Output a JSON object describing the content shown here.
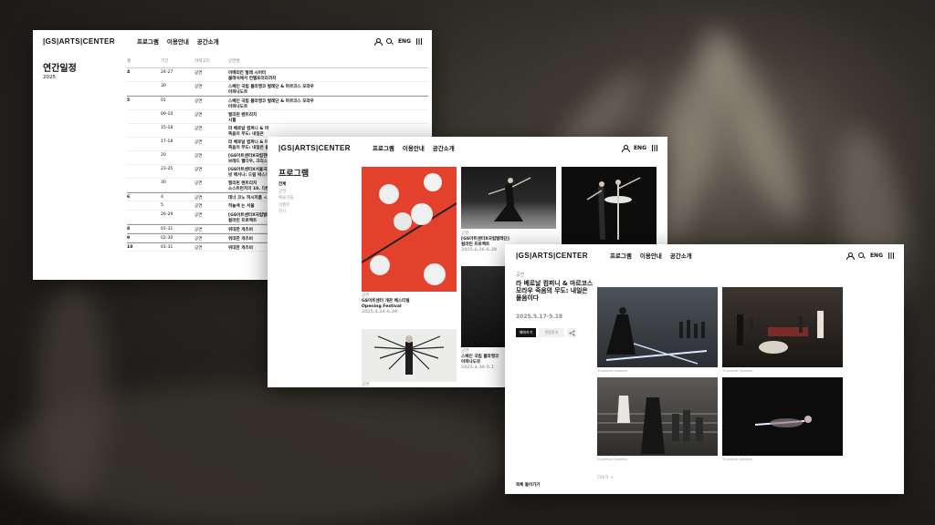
{
  "brand": {
    "logo": "|GS|ARTS|CENTER"
  },
  "nav": {
    "items": [
      "프로그램",
      "이용안내",
      "공간소개"
    ],
    "lang": "ENG"
  },
  "schedule_page": {
    "title": "연간일정",
    "year": "2025",
    "columns": [
      "월",
      "기간",
      "카테고리",
      "공연명"
    ],
    "rows": [
      {
        "month": "4",
        "period": "24-27",
        "category": "공연",
        "title": "아메리칸 발레 시어터",
        "title2": "클래식에서 컨템포러리까지",
        "new_month": true
      },
      {
        "month": "",
        "period": "30",
        "category": "공연",
        "title": "스페인 국립 플라멩코 발레단 & 마르코스 모라우",
        "title2": "아파나도르"
      },
      {
        "month": "5",
        "period": "01",
        "category": "공연",
        "title": "스페인 국립 플라멩코 발레단 & 마르코스 모라우",
        "title2": "아파나도르",
        "new_month": true
      },
      {
        "month": "",
        "period": "09-10",
        "category": "공연",
        "title": "필리핀 렌트리치",
        "title2": "시월"
      },
      {
        "month": "",
        "period": "15-18",
        "category": "공연",
        "title": "라 베로날 컴퍼니 & 마",
        "title2": "죽음의 무도: 내일은"
      },
      {
        "month": "",
        "period": "17-18",
        "category": "공연",
        "title": "라 베로날 컴퍼니 & 마",
        "title2": "죽음의 무도: 내일은 물"
      },
      {
        "month": "",
        "period": "20",
        "category": "공연",
        "title": "[GS아트센터X국립현대",
        "title2": "브레드 웹다우, 크리스티"
      },
      {
        "month": "",
        "period": "23-25",
        "category": "공연",
        "title": "[GS아트센터X서울국제",
        "title2": "빗 메서나: 드림 박스/보"
      },
      {
        "month": "",
        "period": "30",
        "category": "공연",
        "title": "필리핀 렌트리치",
        "title2": "소스트런치의 10. 다른"
      },
      {
        "month": "6",
        "period": "4",
        "category": "공연",
        "title": "데너 코노 허시치홈 <기",
        "new_month": true
      },
      {
        "month": "",
        "period": "5",
        "category": "공연",
        "title": "하늘색 는 서울"
      },
      {
        "month": "",
        "period": "26-29",
        "category": "공연",
        "title": "[GS아트센터X국립발레",
        "title2": "컬러린 프로젝트"
      },
      {
        "month": "8",
        "period": "01-31",
        "category": "공연",
        "title": "위대한 개츠비",
        "new_month": true
      },
      {
        "month": "9",
        "period": "02-30",
        "category": "공연",
        "title": "위대한 개츠비",
        "new_month": true
      },
      {
        "month": "10",
        "period": "01-31",
        "category": "공연",
        "title": "위대한 개츠비",
        "new_month": true
      }
    ]
  },
  "program_page": {
    "title": "프로그램",
    "filters": [
      "전체",
      "공연",
      "예술가들",
      "이벤트",
      "전시"
    ],
    "cards": [
      {
        "category": "공연",
        "title": "GS아트센터 개관 페스티벌",
        "title2": "Opening Festival",
        "date": "2025.4.24-6.29"
      },
      {
        "category": "공연",
        "title": "[GS아트센터X국립발레단]",
        "title2": "컬러린 프로젝트",
        "date": "2025.6.26-6.29"
      },
      {
        "category": "공연",
        "title": "스페인 국립 플라멩코",
        "title2": "아파나도르",
        "date": "2025.4.30-5.1"
      },
      {
        "category": "공연",
        "title": "",
        "title2": "",
        "date": ""
      }
    ]
  },
  "detail_page": {
    "category": "공연",
    "title": "라 베로날 컴퍼니 & 마르코스 모라우 죽음의 무도: 내일은 물음이다",
    "date": "2025.5.17-5.18",
    "buttons": {
      "primary": "예매하기",
      "secondary": "관람후기"
    },
    "credit": "©Lorenzo Sanento",
    "more": "더보기 →",
    "back": "목록 돌아가기"
  }
}
